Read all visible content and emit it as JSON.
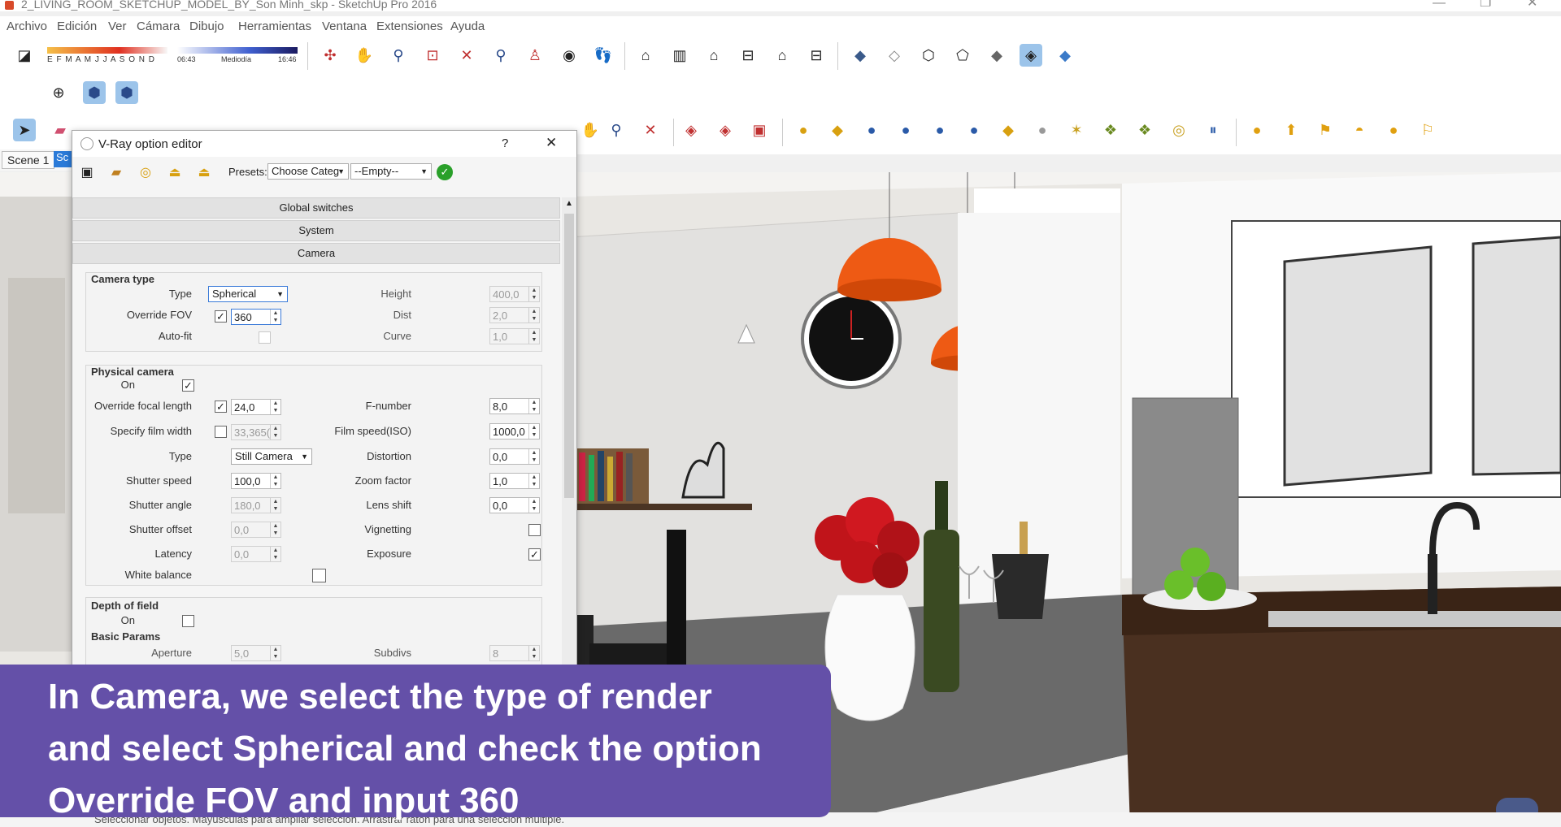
{
  "window": {
    "title": "2_LIVING_ROOM_SKETCHUP_MODEL_BY_Son Minh_skp - SketchUp Pro 2016",
    "minimize": "—",
    "maximize": "❐",
    "close": "✕"
  },
  "menu": [
    "Archivo",
    "Edición",
    "Ver",
    "Cámara",
    "Dibujo",
    "Herramientas",
    "Ventana",
    "Extensiones",
    "Ayuda"
  ],
  "shadow_bar": {
    "months": "E F M A M J J A S O N D",
    "time_start": "06:43",
    "time_mid": "Mediodía",
    "time_end": "16:46"
  },
  "scenes": {
    "tab1": "Scene 1",
    "tab2": "Sc"
  },
  "dialog": {
    "title": "V-Ray option editor",
    "help": "?",
    "close": "✕",
    "presets_label": "Presets:",
    "presets_category": "Choose Categ",
    "presets_value": "--Empty--",
    "sections": [
      "Global switches",
      "System",
      "Camera"
    ],
    "camera_type": {
      "label": "Camera type",
      "type_label": "Type",
      "type_value": "Spherical",
      "override_fov_label": "Override FOV",
      "override_fov_value": "360",
      "override_fov_checked": "✓",
      "autofit_label": "Auto-fit",
      "height_label": "Height",
      "height_value": "400,0",
      "dist_label": "Dist",
      "dist_value": "2,0",
      "curve_label": "Curve",
      "curve_value": "1,0"
    },
    "physical_camera": {
      "label": "Physical camera",
      "on_label": "On",
      "on_checked": "✓",
      "focal_label": "Override focal length",
      "focal_value": "24,0",
      "focal_checked": "✓",
      "film_label": "Specify film width",
      "film_value": "33,365(",
      "type_label": "Type",
      "type_value": "Still Camera",
      "shutter_speed_label": "Shutter speed",
      "shutter_speed_value": "100,0",
      "shutter_angle_label": "Shutter angle",
      "shutter_angle_value": "180,0",
      "shutter_offset_label": "Shutter offset",
      "shutter_offset_value": "0,0",
      "latency_label": "Latency",
      "latency_value": "0,0",
      "white_balance_label": "White balance",
      "fnumber_label": "F-number",
      "fnumber_value": "8,0",
      "iso_label": "Film speed(ISO)",
      "iso_value": "1000,0",
      "distortion_label": "Distortion",
      "distortion_value": "0,0",
      "zoom_label": "Zoom factor",
      "zoom_value": "1,0",
      "lens_shift_label": "Lens shift",
      "lens_shift_value": "0,0",
      "vignetting_label": "Vignetting",
      "exposure_label": "Exposure",
      "exposure_checked": "✓"
    },
    "dof": {
      "label": "Depth of field",
      "on_label": "On",
      "basic_label": "Basic Params",
      "aperture_label": "Aperture",
      "aperture_value": "5,0",
      "subdivs_label": "Subdivs",
      "subdivs_value": "8"
    }
  },
  "subtitle": {
    "line1": "In Camera, we select the type of render",
    "line2": "and select Spherical and check the option",
    "line3": "Override FOV and input 360"
  },
  "status": {
    "text": "Seleccionar objetos. Mayúsculas para ampliar selección. Arrastrar ratón para una selección múltiple."
  },
  "colors": {
    "subtitle_bg": "#6450a8",
    "lamp_orange": "#ee5a14",
    "accent_blue": "#2a7ad8"
  }
}
